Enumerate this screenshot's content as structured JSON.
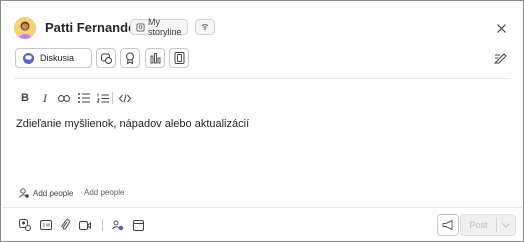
{
  "header": {
    "author_name": "Patti Fernandez",
    "audience_label": "My storyline",
    "close_icon": "close-icon",
    "visibility_icon": "broadcast-icon"
  },
  "compose_options": {
    "discussion_label": "Diskusia",
    "buttons": [
      "praise-icon",
      "badge-icon",
      "poll-icon",
      "notebook-icon"
    ],
    "formatting_toggle_icon": "edit-format-icon"
  },
  "editor": {
    "toolbar": [
      "bold-icon",
      "italic-icon",
      "link-icon",
      "bulleted-list-icon",
      "numbered-list-icon",
      "code-icon"
    ],
    "placeholder": "Zdieľanie myšlienok, nápadov alebo aktualizácií"
  },
  "people": {
    "add_people_label": "Add people",
    "add_people_hint": "Add people"
  },
  "footer": {
    "tools": [
      "attach-person-icon",
      "gif-icon",
      "attach-file-icon",
      "video-icon",
      "people-group-icon",
      "calendar-icon"
    ],
    "post_label": "Post"
  },
  "colors": {
    "accent": "#5b5fc7",
    "avatar_bg": "#e9c46a"
  }
}
